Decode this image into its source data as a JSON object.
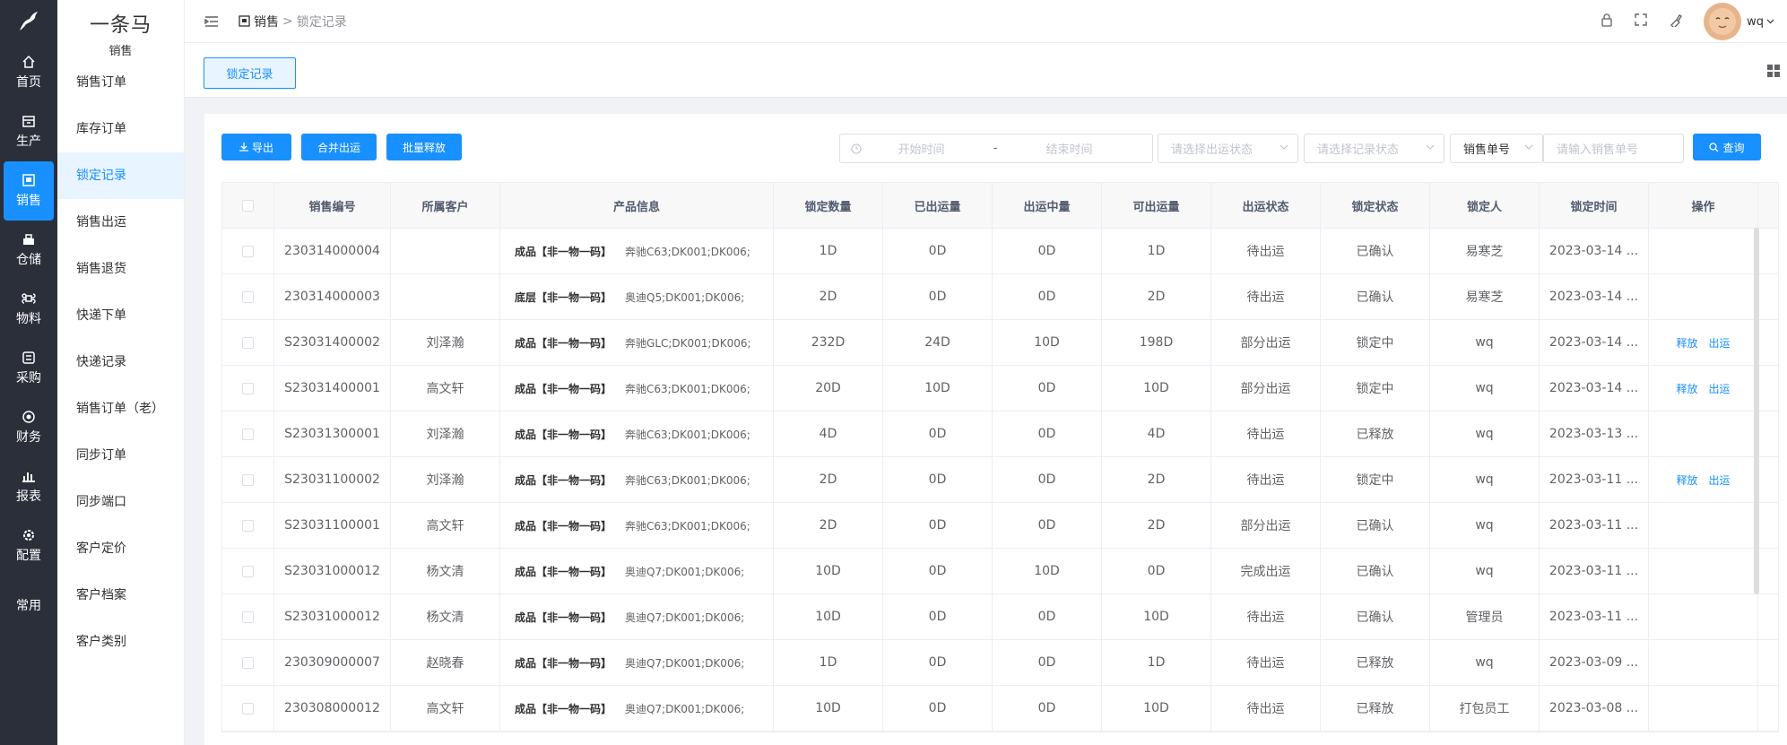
{
  "rail": {
    "items": [
      {
        "label": "首页",
        "icon": "home-icon"
      },
      {
        "label": "生产",
        "icon": "factory-icon"
      },
      {
        "label": "销售",
        "icon": "sales-icon"
      },
      {
        "label": "仓储",
        "icon": "warehouse-icon"
      },
      {
        "label": "物料",
        "icon": "command-icon"
      },
      {
        "label": "采购",
        "icon": "purchase-icon"
      },
      {
        "label": "财务",
        "icon": "finance-icon"
      },
      {
        "label": "报表",
        "icon": "chart-icon"
      },
      {
        "label": "配置",
        "icon": "gear-icon"
      },
      {
        "label": "常用",
        "icon": ""
      }
    ]
  },
  "brand": {
    "name": "一条马",
    "section": "销售"
  },
  "sidebar": {
    "items": [
      "销售订单",
      "库存订单",
      "锁定记录",
      "销售出运",
      "销售退货",
      "快递下单",
      "快递记录",
      "销售订单（老）",
      "同步订单",
      "同步端口",
      "客户定价",
      "客户档案",
      "客户类别"
    ]
  },
  "header": {
    "crumb1": "销售",
    "crumb_sep": ">",
    "crumb2": "锁定记录",
    "username": "wq"
  },
  "tags": {
    "active": "锁定记录"
  },
  "toolbar": {
    "export": "导出",
    "merge": "合并出运",
    "release": "批量释放"
  },
  "filters": {
    "start_placeholder": "开始时间",
    "range_sep": "-",
    "end_placeholder": "结束时间",
    "ship_status_placeholder": "请选择出运状态",
    "record_status_placeholder": "请选择记录状态",
    "order_type": "销售单号",
    "order_placeholder": "请输入销售单号",
    "search": "查询"
  },
  "table": {
    "headers": [
      "销售编号",
      "所属客户",
      "产品信息",
      "锁定数量",
      "已出运量",
      "出运中量",
      "可出运量",
      "出运状态",
      "锁定状态",
      "锁定人",
      "锁定时间",
      "操作"
    ],
    "rows": [
      {
        "no": "230314000004",
        "customer": "",
        "ptype": "成品【非一物一码】",
        "pdesc": "奔驰C63;DK001;DK006;",
        "lock": "1D",
        "shipped": "0D",
        "shipping": "0D",
        "avail": "1D",
        "ship_status": "待出运",
        "lock_status": "已确认",
        "locker": "易寒芝",
        "time": "2023-03-14 ...",
        "ops": []
      },
      {
        "no": "230314000003",
        "customer": "",
        "ptype": "底层【非一物一码】",
        "pdesc": "奥迪Q5;DK001;DK006;",
        "lock": "2D",
        "shipped": "0D",
        "shipping": "0D",
        "avail": "2D",
        "ship_status": "待出运",
        "lock_status": "已确认",
        "locker": "易寒芝",
        "time": "2023-03-14 ...",
        "ops": []
      },
      {
        "no": "S23031400002",
        "customer": "刘泽瀚",
        "ptype": "成品【非一物一码】",
        "pdesc": "奔驰GLC;DK001;DK006;",
        "lock": "232D",
        "shipped": "24D",
        "shipping": "10D",
        "avail": "198D",
        "ship_status": "部分出运",
        "lock_status": "锁定中",
        "locker": "wq",
        "time": "2023-03-14 ...",
        "ops": [
          "释放",
          "出运"
        ]
      },
      {
        "no": "S23031400001",
        "customer": "高文轩",
        "ptype": "成品【非一物一码】",
        "pdesc": "奔驰C63;DK001;DK006;",
        "lock": "20D",
        "shipped": "10D",
        "shipping": "0D",
        "avail": "10D",
        "ship_status": "部分出运",
        "lock_status": "锁定中",
        "locker": "wq",
        "time": "2023-03-14 ...",
        "ops": [
          "释放",
          "出运"
        ]
      },
      {
        "no": "S23031300001",
        "customer": "刘泽瀚",
        "ptype": "成品【非一物一码】",
        "pdesc": "奔驰C63;DK001;DK006;",
        "lock": "4D",
        "shipped": "0D",
        "shipping": "0D",
        "avail": "4D",
        "ship_status": "待出运",
        "lock_status": "已释放",
        "locker": "wq",
        "time": "2023-03-13 ...",
        "ops": []
      },
      {
        "no": "S23031100002",
        "customer": "刘泽瀚",
        "ptype": "成品【非一物一码】",
        "pdesc": "奔驰C63;DK001;DK006;",
        "lock": "2D",
        "shipped": "0D",
        "shipping": "0D",
        "avail": "2D",
        "ship_status": "待出运",
        "lock_status": "锁定中",
        "locker": "wq",
        "time": "2023-03-11 ...",
        "ops": [
          "释放",
          "出运"
        ]
      },
      {
        "no": "S23031100001",
        "customer": "高文轩",
        "ptype": "成品【非一物一码】",
        "pdesc": "奔驰C63;DK001;DK006;",
        "lock": "2D",
        "shipped": "0D",
        "shipping": "0D",
        "avail": "2D",
        "ship_status": "部分出运",
        "lock_status": "已确认",
        "locker": "wq",
        "time": "2023-03-11 ...",
        "ops": []
      },
      {
        "no": "S23031000012",
        "customer": "杨文清",
        "ptype": "成品【非一物一码】",
        "pdesc": "奥迪Q7;DK001;DK006;",
        "lock": "10D",
        "shipped": "0D",
        "shipping": "10D",
        "avail": "0D",
        "ship_status": "完成出运",
        "lock_status": "已确认",
        "locker": "wq",
        "time": "2023-03-11 ...",
        "ops": []
      },
      {
        "no": "S23031000012",
        "customer": "杨文清",
        "ptype": "成品【非一物一码】",
        "pdesc": "奥迪Q7;DK001;DK006;",
        "lock": "10D",
        "shipped": "0D",
        "shipping": "0D",
        "avail": "10D",
        "ship_status": "待出运",
        "lock_status": "已确认",
        "locker": "管理员",
        "time": "2023-03-11 ...",
        "ops": []
      },
      {
        "no": "230309000007",
        "customer": "赵晓春",
        "ptype": "成品【非一物一码】",
        "pdesc": "奥迪Q7;DK001;DK006;",
        "lock": "1D",
        "shipped": "0D",
        "shipping": "0D",
        "avail": "1D",
        "ship_status": "待出运",
        "lock_status": "已释放",
        "locker": "wq",
        "time": "2023-03-09 ...",
        "ops": []
      },
      {
        "no": "230308000012",
        "customer": "高文轩",
        "ptype": "成品【非一物一码】",
        "pdesc": "奥迪Q7;DK001;DK006;",
        "lock": "10D",
        "shipped": "0D",
        "shipping": "0D",
        "avail": "10D",
        "ship_status": "待出运",
        "lock_status": "已释放",
        "locker": "打包员工",
        "time": "2023-03-08 ...",
        "ops": []
      }
    ]
  },
  "colors": {
    "primary": "#1890ff",
    "rail": "#2b2f3a"
  }
}
